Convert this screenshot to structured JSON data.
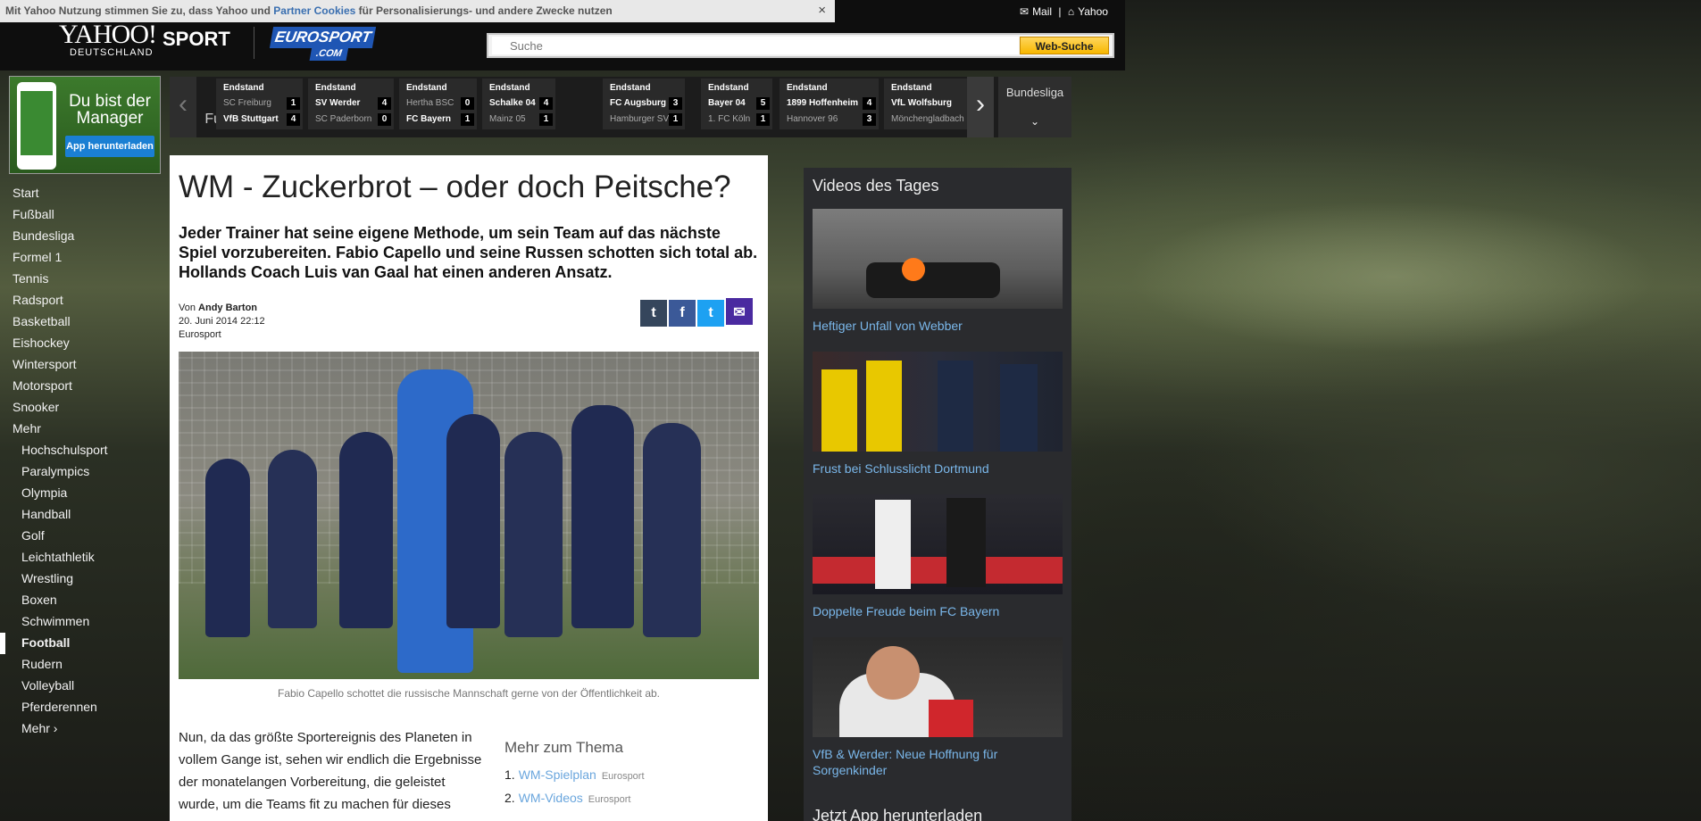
{
  "cookie": {
    "text_a": "Mit Yahoo Nutzung stimmen Sie zu, dass Yahoo und ",
    "link": "Partner Cookies",
    "text_b": " für Personalisierungs- und andere Zwecke nutzen",
    "close": "×"
  },
  "toplinks": {
    "mail": "Mail",
    "sep": "|",
    "yahoo": "Yahoo"
  },
  "logo": {
    "yahoo": "YAHOO!",
    "sport": "SPORT",
    "region": "DEUTSCHLAND",
    "euro1": "EUROSPORT",
    "euro2": ".COM"
  },
  "search": {
    "placeholder": "Suche",
    "button": "Web-Suche"
  },
  "ad": {
    "title": "Du bist der Manager",
    "button": "App herunterladen"
  },
  "scores": {
    "sport": "Fußball",
    "league": "Bundesliga",
    "games": [
      {
        "status": "Endstand",
        "home": "SC Freiburg",
        "away": "VfB Stuttgart",
        "hs": "1",
        "as": "4",
        "winner": "away"
      },
      {
        "status": "Endstand",
        "home": "SV Werder",
        "away": "SC Paderborn",
        "hs": "4",
        "as": "0",
        "winner": "home"
      },
      {
        "status": "Endstand",
        "home": "Hertha BSC",
        "away": "FC Bayern",
        "hs": "0",
        "as": "1",
        "winner": "away"
      },
      {
        "status": "Endstand",
        "home": "Schalke 04",
        "away": "Mainz 05",
        "hs": "4",
        "as": "1",
        "winner": "home"
      },
      {
        "status": "Endstand",
        "home": "FC Augsburg",
        "away": "Hamburger SV",
        "hs": "3",
        "as": "1",
        "winner": "home"
      },
      {
        "status": "Endstand",
        "home": "Bayer 04",
        "away": "1. FC Köln",
        "hs": "5",
        "as": "1",
        "winner": "home"
      },
      {
        "status": "Endstand",
        "home": "1899 Hoffenheim",
        "away": "Hannover 96",
        "hs": "4",
        "as": "3",
        "winner": "home"
      },
      {
        "status": "Endstand",
        "home": "VfL Wolfsburg",
        "away": "Mönchengladbach",
        "hs": "",
        "as": "",
        "winner": "home"
      }
    ]
  },
  "nav": {
    "items": [
      "Start",
      "Fußball",
      "Bundesliga",
      "Formel 1",
      "Tennis",
      "Radsport",
      "Basketball",
      "Eishockey",
      "Wintersport",
      "Motorsport",
      "Snooker",
      "Mehr"
    ],
    "sub": [
      "Hochschulsport",
      "Paralympics",
      "Olympia",
      "Handball",
      "Golf",
      "Leichtathletik",
      "Wrestling",
      "Boxen",
      "Schwimmen",
      "Football",
      "Rudern",
      "Volleyball",
      "Pferderennen",
      "Mehr ›"
    ]
  },
  "article": {
    "title": "WM - Zuckerbrot – oder doch Peitsche?",
    "lead": "Jeder Trainer hat seine eigene Methode, um sein Team auf das nächste Spiel vorzubereiten. Fabio Capello und seine Russen schotten sich total ab. Hollands Coach Luis van Gaal hat einen anderen Ansatz.",
    "by_prefix": "Von ",
    "author": "Andy Barton",
    "date": "20. Juni 2014 22:12",
    "source": "Eurosport",
    "caption": "Fabio Capello schottet die russische Mannschaft gerne von der Öffentlichkeit ab.",
    "body": "Nun, da das größte Sportereignis des Planeten in vollem Gange ist, sehen wir endlich die Ergebnisse der monatelangen Vorbereitung, die geleistet wurde, um die Teams fit zu machen für dieses hochintensive und rasante Fußballfestival. Aber wie"
  },
  "share": {
    "tumblr": "t",
    "facebook": "f",
    "twitter": "t",
    "mail": "✉"
  },
  "more": {
    "heading": "Mehr zum Thema",
    "items": [
      {
        "n": "1.",
        "label": "WM-Spielplan",
        "src": "Eurosport"
      },
      {
        "n": "2.",
        "label": "WM-Videos",
        "src": "Eurosport"
      }
    ]
  },
  "videos": {
    "heading": "Videos des Tages",
    "items": [
      "Heftiger Unfall von Webber",
      "Frust bei Schlusslicht Dortmund",
      "Doppelte Freude beim FC Bayern",
      "VfB & Werder: Neue Hoffnung für Sorgenkinder"
    ],
    "app": "Jetzt App herunterladen"
  },
  "colors": {
    "accent": "#f7b700",
    "link": "#7ab7ea",
    "tumblr": "#35465c",
    "facebook": "#3b5998",
    "twitter": "#1da1f2",
    "mail": "#4a2aa0"
  }
}
